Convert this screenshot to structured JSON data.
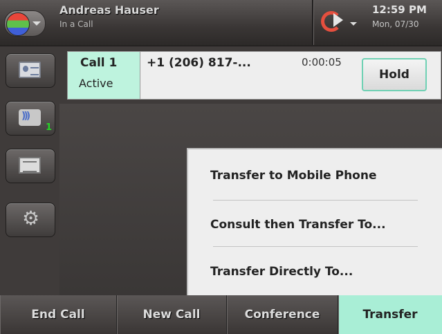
{
  "header": {
    "user_name": "Andreas Hauser",
    "user_status": "In a Call",
    "time": "12:59 PM",
    "date": "Mon, 07/30"
  },
  "side_nav": [
    {
      "icon": "contacts-icon"
    },
    {
      "icon": "voicemail-icon",
      "badge": "1"
    },
    {
      "icon": "documents-icon"
    },
    {
      "icon": "settings-icon"
    }
  ],
  "call": {
    "label": "Call 1",
    "state": "Active",
    "number": "+1 (206) 817-...",
    "duration": "0:00:05",
    "hold_label": "Hold"
  },
  "transfer_menu": {
    "items": [
      "Transfer to Mobile Phone",
      "Consult then Transfer To...",
      "Transfer Directly To..."
    ]
  },
  "softkeys": [
    {
      "label": "End Call"
    },
    {
      "label": "New Call"
    },
    {
      "label": "Conference"
    },
    {
      "label": "Transfer",
      "active": true
    }
  ],
  "colors": {
    "accent": "#bef3de",
    "active_softkey": "#a9eed6",
    "voicemail_badge": "#27d427"
  }
}
